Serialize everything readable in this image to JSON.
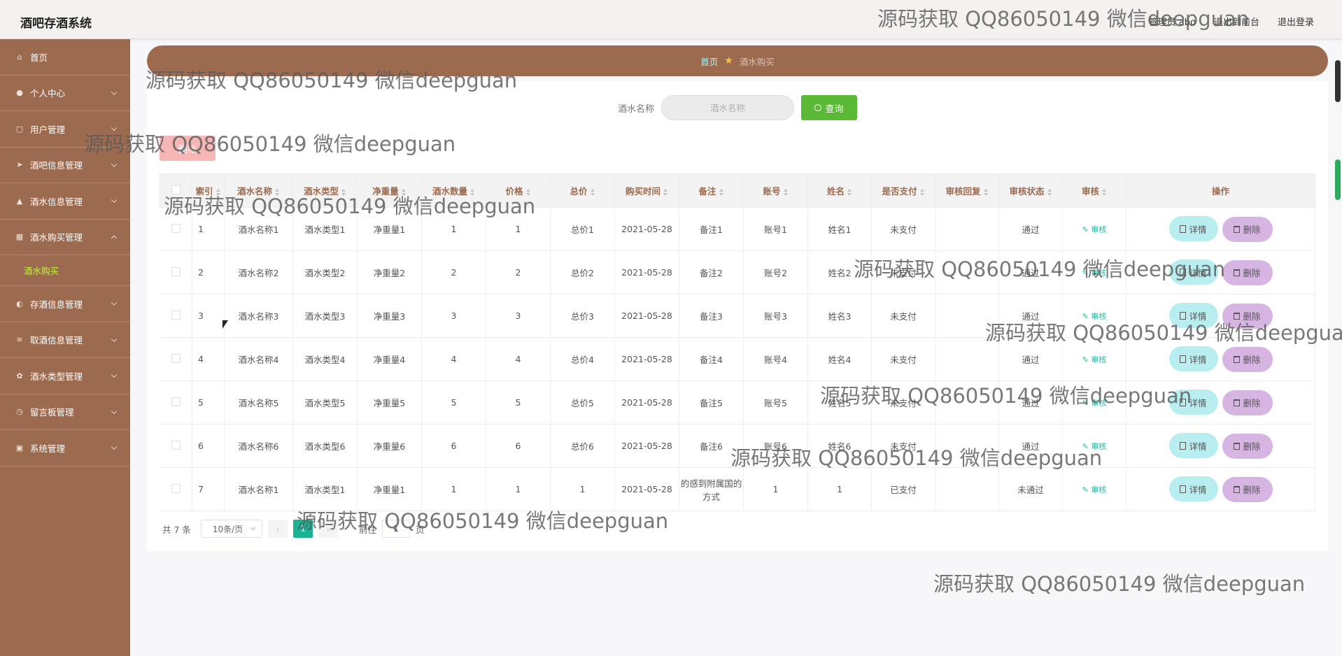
{
  "header": {
    "app_title": "酒吧存酒系统",
    "admin_label": "管理员 abo",
    "front_link": "退出到前台",
    "logout": "退出登录"
  },
  "sidebar": {
    "items": [
      {
        "label": "首页",
        "icon": "home-icon",
        "expandable": false
      },
      {
        "label": "个人中心",
        "icon": "user-icon",
        "expandable": true
      },
      {
        "label": "用户管理",
        "icon": "copy-icon",
        "expandable": true
      },
      {
        "label": "酒吧信息管理",
        "icon": "send-icon",
        "expandable": true
      },
      {
        "label": "酒水信息管理",
        "icon": "thumb-icon",
        "expandable": true
      },
      {
        "label": "酒水购买管理",
        "icon": "grid-icon",
        "expandable": true,
        "expanded": true
      },
      {
        "label": "存酒信息管理",
        "icon": "mic-icon",
        "expandable": true
      },
      {
        "label": "取酒信息管理",
        "icon": "sliders-icon",
        "expandable": true
      },
      {
        "label": "酒水类型管理",
        "icon": "settings-icon",
        "expandable": true
      },
      {
        "label": "留言板管理",
        "icon": "clock-icon",
        "expandable": true
      },
      {
        "label": "系统管理",
        "icon": "message-icon",
        "expandable": true
      }
    ],
    "active_sub": "酒水购买"
  },
  "breadcrumb": {
    "home": "首页",
    "current": "酒水购买"
  },
  "search": {
    "label": "酒水名称",
    "placeholder": "酒水名称",
    "button": "查询"
  },
  "delete_button": "删除",
  "table": {
    "headers": [
      "索引",
      "酒水名称",
      "酒水类型",
      "净重量",
      "酒水数量",
      "价格",
      "总价",
      "购买时间",
      "备注",
      "账号",
      "姓名",
      "是否支付",
      "审核回复",
      "审核状态",
      "审核",
      "操作"
    ],
    "rows": [
      {
        "index": "1",
        "name": "酒水名称1",
        "type": "酒水类型1",
        "weight": "净重量1",
        "qty": "1",
        "price": "1",
        "total": "总价1",
        "time": "2021-05-28",
        "remark": "备注1",
        "account": "账号1",
        "person": "姓名1",
        "paid": "未支付",
        "reply": "",
        "status": "通过",
        "review": "审核"
      },
      {
        "index": "2",
        "name": "酒水名称2",
        "type": "酒水类型2",
        "weight": "净重量2",
        "qty": "2",
        "price": "2",
        "total": "总价2",
        "time": "2021-05-28",
        "remark": "备注2",
        "account": "账号2",
        "person": "姓名2",
        "paid": "未支付",
        "reply": "",
        "status": "通过",
        "review": "审核"
      },
      {
        "index": "3",
        "name": "酒水名称3",
        "type": "酒水类型3",
        "weight": "净重量3",
        "qty": "3",
        "price": "3",
        "total": "总价3",
        "time": "2021-05-28",
        "remark": "备注3",
        "account": "账号3",
        "person": "姓名3",
        "paid": "未支付",
        "reply": "",
        "status": "通过",
        "review": "审核"
      },
      {
        "index": "4",
        "name": "酒水名称4",
        "type": "酒水类型4",
        "weight": "净重量4",
        "qty": "4",
        "price": "4",
        "total": "总价4",
        "time": "2021-05-28",
        "remark": "备注4",
        "account": "账号4",
        "person": "姓名4",
        "paid": "未支付",
        "reply": "",
        "status": "通过",
        "review": "审核"
      },
      {
        "index": "5",
        "name": "酒水名称5",
        "type": "酒水类型5",
        "weight": "净重量5",
        "qty": "5",
        "price": "5",
        "total": "总价5",
        "time": "2021-05-28",
        "remark": "备注5",
        "account": "账号5",
        "person": "姓名5",
        "paid": "未支付",
        "reply": "",
        "status": "通过",
        "review": "审核"
      },
      {
        "index": "6",
        "name": "酒水名称6",
        "type": "酒水类型6",
        "weight": "净重量6",
        "qty": "6",
        "price": "6",
        "total": "总价6",
        "time": "2021-05-28",
        "remark": "备注6",
        "account": "账号6",
        "person": "姓名6",
        "paid": "未支付",
        "reply": "",
        "status": "通过",
        "review": "审核"
      },
      {
        "index": "7",
        "name": "酒水名称1",
        "type": "酒水类型1",
        "weight": "净重量1",
        "qty": "1",
        "price": "1",
        "total": "1",
        "time": "2021-05-28",
        "remark": "的感到附属国的方式",
        "account": "1",
        "person": "1",
        "paid": "已支付",
        "reply": "",
        "status": "未通过",
        "review": "审核"
      }
    ],
    "detail_label": "详情",
    "delete_label": "删除"
  },
  "pagination": {
    "total": "共 7 条",
    "page_size": "10条/页",
    "prev": "‹",
    "current_page": "1",
    "next": "›",
    "goto_label": "前往",
    "goto_value": "1",
    "page_unit": "页"
  },
  "watermark": "源码获取 QQ86050149 微信deepguan",
  "colors": {
    "sidebar": "#9c6a4e",
    "active_sub": "#c8f04a",
    "search_button": "#5ab935",
    "detail_button": "#b8eef0",
    "delete_button": "#d6b5e3",
    "pagination_active": "#19b394"
  }
}
